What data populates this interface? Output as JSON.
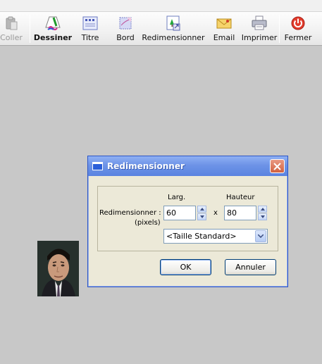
{
  "toolbar": {
    "buttons": [
      {
        "id": "coller",
        "label": "Coller",
        "icon": "paste-icon",
        "enabled": false
      },
      {
        "id": "dessiner",
        "label": "Dessiner",
        "icon": "draw-icon",
        "enabled": true
      },
      {
        "id": "titre",
        "label": "Titre",
        "icon": "title-icon",
        "enabled": true
      },
      {
        "id": "bord",
        "label": "Bord",
        "icon": "border-icon",
        "enabled": true
      },
      {
        "id": "redimensionner",
        "label": "Redimensionner",
        "icon": "resize-icon",
        "enabled": true
      },
      {
        "id": "email",
        "label": "Email",
        "icon": "email-icon",
        "enabled": true
      },
      {
        "id": "imprimer",
        "label": "Imprimer",
        "icon": "printer-icon",
        "enabled": true
      },
      {
        "id": "fermer",
        "label": "Fermer",
        "icon": "power-icon",
        "enabled": true
      }
    ]
  },
  "dialog": {
    "title": "Redimensionner",
    "width_header": "Larg.",
    "height_header": "Hauteur",
    "resize_label": "Redimensionner :",
    "unit_label": "(pixels)",
    "width_value": "60",
    "times_sign": "x",
    "height_value": "80",
    "size_preset": "<Taille Standard>",
    "ok_label": "OK",
    "cancel_label": "Annuler"
  },
  "colors": {
    "titlebar": "#6d93e7",
    "dialog_bg": "#ece9d8",
    "workspace_bg": "#c8c8c8",
    "close_button": "#d2613f"
  }
}
